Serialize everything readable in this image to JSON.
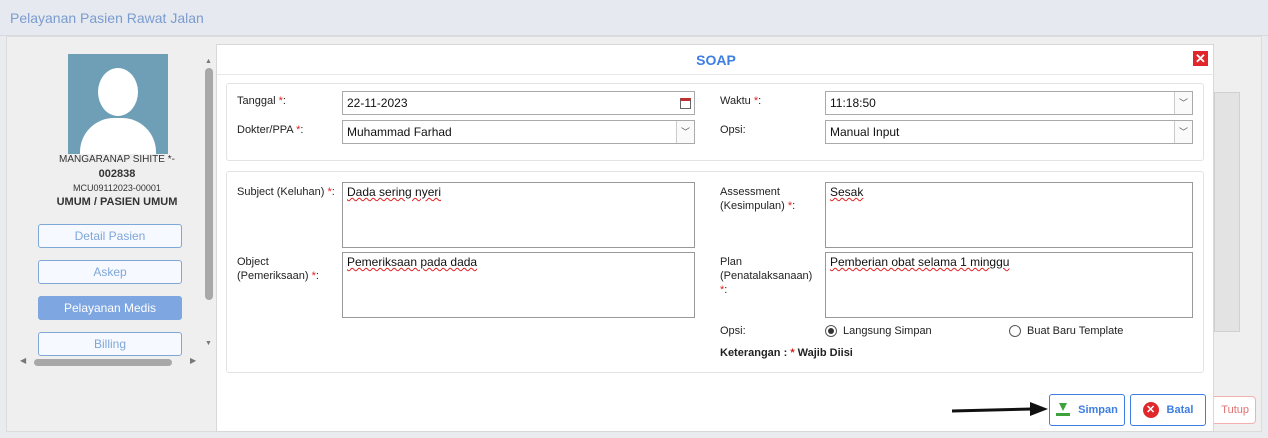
{
  "page": {
    "title": "Pelayanan Pasien Rawat Jalan",
    "close_label": "Tutup"
  },
  "patient": {
    "name": "MANGARANAP SIHITE *-",
    "number": "002838",
    "code": "MCU09112023-00001",
    "type": "UMUM / PASIEN UMUM"
  },
  "sidebar": {
    "items": [
      {
        "label": "Detail Pasien"
      },
      {
        "label": "Askep"
      },
      {
        "label": "Pelayanan Medis"
      },
      {
        "label": "Billing"
      }
    ]
  },
  "modal": {
    "title": "SOAP",
    "close_glyph": "✕",
    "tanggal": {
      "label": "Tanggal",
      "value": "22-11-2023"
    },
    "waktu": {
      "label": "Waktu",
      "value": "11:18:50"
    },
    "dokter": {
      "label": "Dokter/PPA",
      "value": "Muhammad Farhad"
    },
    "opsi_top": {
      "label": "Opsi:",
      "value": "Manual Input"
    },
    "subject": {
      "label": "Subject (Keluhan)",
      "value": "Dada sering nyeri"
    },
    "assessment": {
      "label_1": "Assessment",
      "label_2": "(Kesimpulan)",
      "value": "Sesak"
    },
    "object": {
      "label_1": "Object",
      "label_2": "(Pemeriksaan)",
      "value": "Pemeriksaan pada dada"
    },
    "plan": {
      "label_1": "Plan",
      "label_2": "(Penatalaksanaan)",
      "value": "Pemberian obat selama 1 minggu"
    },
    "opsi_bottom": {
      "label": "Opsi:",
      "options": [
        {
          "label": "Langsung Simpan",
          "checked": true
        },
        {
          "label": "Buat Baru Template",
          "checked": false
        }
      ]
    },
    "note": {
      "prefix": "Keterangan :",
      "star": "*",
      "text": "Wajib Diisi"
    },
    "required_mark": "*",
    "buttons": {
      "save": "Simpan",
      "cancel": "Batal"
    }
  },
  "icons": [
    "user-avatar-icon",
    "calendar-icon",
    "chevron-down-icon",
    "close-icon",
    "download-save-icon",
    "cancel-circle-icon",
    "arrow-right-icon"
  ]
}
